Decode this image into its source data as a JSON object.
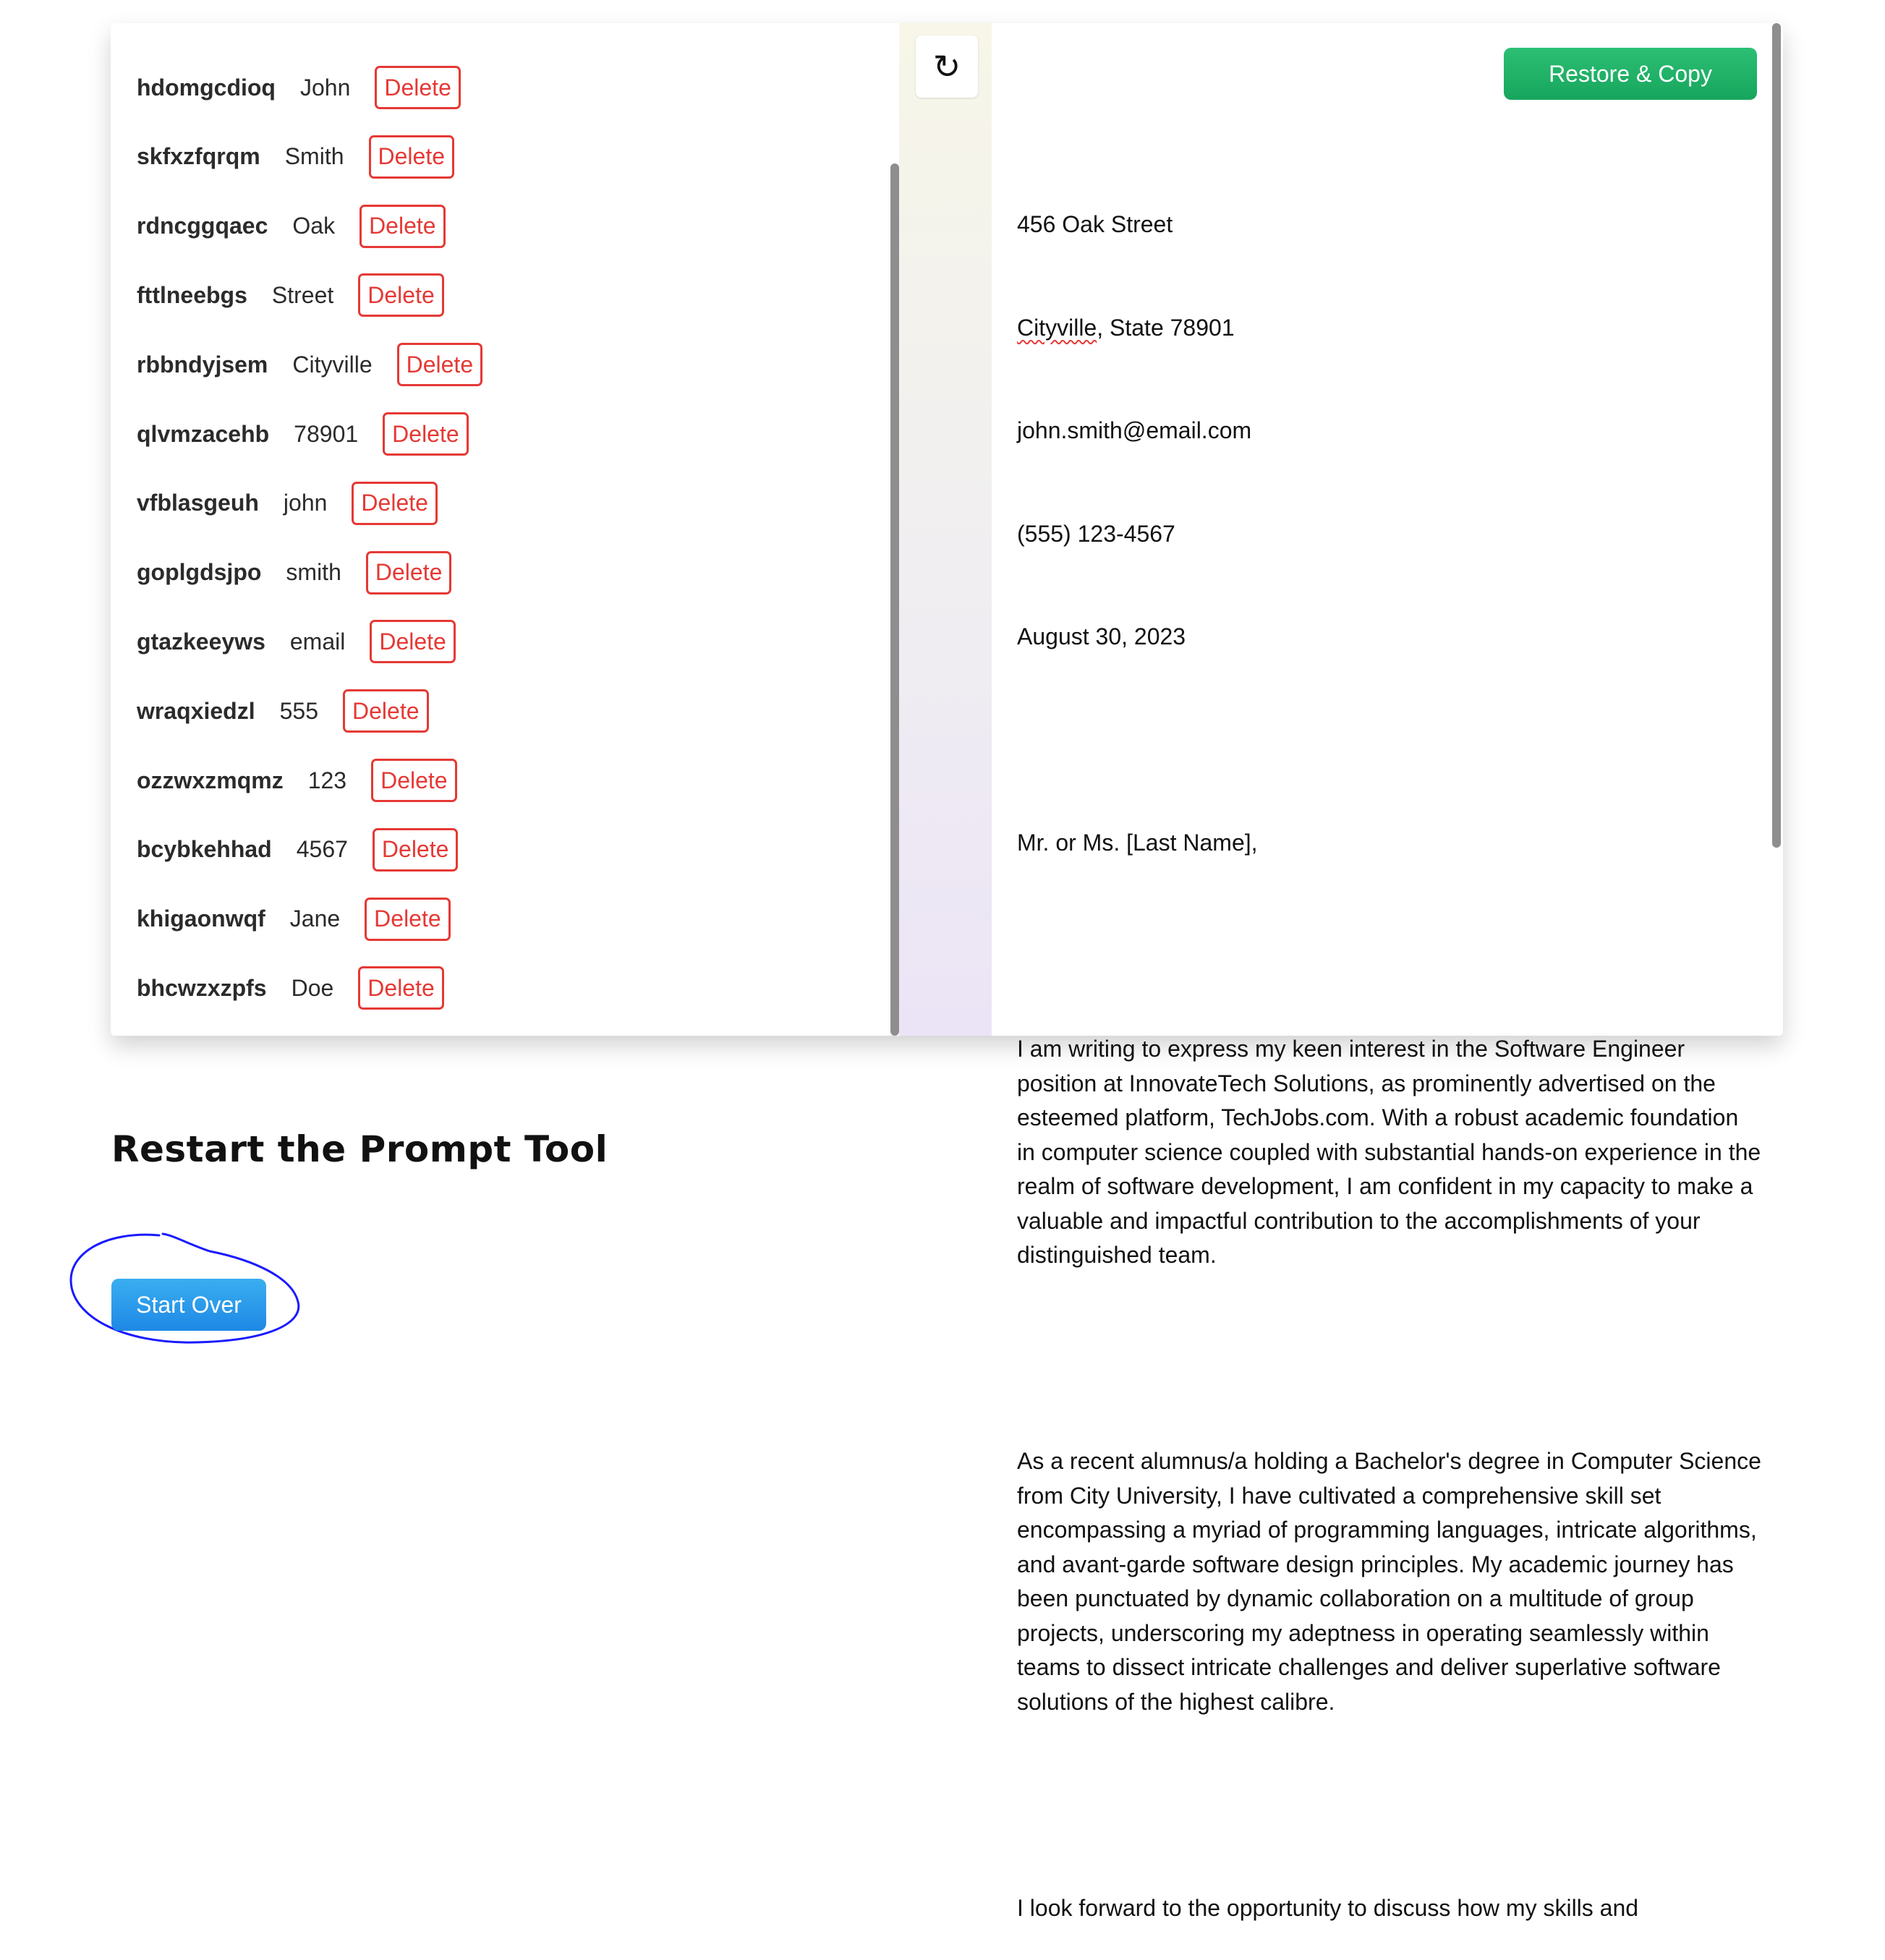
{
  "entries": [
    {
      "code": "hdomgcdioq",
      "value": "John",
      "action": "Delete"
    },
    {
      "code": "skfxzfqrqm",
      "value": "Smith",
      "action": "Delete"
    },
    {
      "code": "rdncggqaec",
      "value": "Oak",
      "action": "Delete"
    },
    {
      "code": "fttlneebgs",
      "value": "Street",
      "action": "Delete"
    },
    {
      "code": "rbbndyjsem",
      "value": "Cityville",
      "action": "Delete"
    },
    {
      "code": "qlvmzacehb",
      "value": "78901",
      "action": "Delete"
    },
    {
      "code": "vfblasgeuh",
      "value": "john",
      "action": "Delete"
    },
    {
      "code": "goplgdsjpo",
      "value": "smith",
      "action": "Delete"
    },
    {
      "code": "gtazkeeyws",
      "value": "email",
      "action": "Delete"
    },
    {
      "code": "wraqxiedzl",
      "value": "555",
      "action": "Delete"
    },
    {
      "code": "ozzwxzmqmz",
      "value": "123",
      "action": "Delete"
    },
    {
      "code": "bcybkehhad",
      "value": "4567",
      "action": "Delete"
    },
    {
      "code": "khigaonwqf",
      "value": "Jane",
      "action": "Delete"
    },
    {
      "code": "bhcwzxzpfs",
      "value": "Doe",
      "action": "Delete"
    }
  ],
  "toolbar": {
    "refresh_glyph": "↻",
    "restore_copy_label": "Restore & Copy"
  },
  "letter": {
    "line1": "456 Oak Street",
    "city_word": "Cityville",
    "city_rest": ", State 78901",
    "email": "john.smith@email.com",
    "phone": "(555) 123-4567",
    "date": "August 30, 2023",
    "salutation": "Mr. or Ms. [Last Name],",
    "para1": "I am writing to express my keen interest in the Software Engineer position at InnovateTech Solutions, as prominently advertised on the esteemed platform, TechJobs.com. With a robust academic foundation in computer science coupled with substantial hands-on experience in the realm of software development, I am confident in my capacity to make a valuable and impactful contribution to the accomplishments of your distinguished team.",
    "para2": "As a recent alumnus/a holding a Bachelor's degree in Computer Science from City University, I have cultivated a comprehensive skill set encompassing a myriad of programming languages, intricate algorithms, and avant-garde software design principles. My academic journey has been punctuated by dynamic collaboration on a multitude of group projects, underscoring my adeptness in operating seamlessly within teams to dissect intricate challenges and deliver superlative software solutions of the highest calibre.",
    "para3": "I look forward to the opportunity to discuss how my skills and"
  },
  "restart": {
    "title": "Restart the Prompt Tool",
    "button_label": "Start Over"
  },
  "colors": {
    "delete": "#e53935",
    "copy_button": "#1fae66",
    "start_button": "#2196f3",
    "annotation": "#1a1aff"
  }
}
